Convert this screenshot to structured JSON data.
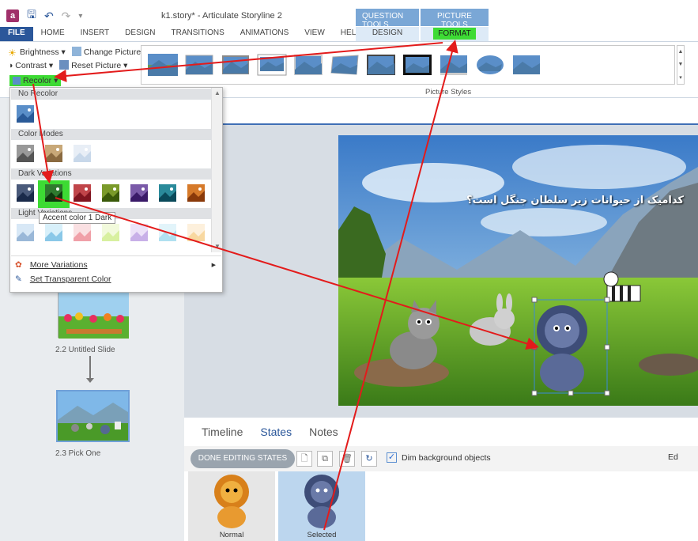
{
  "window": {
    "title": "k1.story* - Articulate Storyline 2",
    "context_tabs": {
      "question_tools": "QUESTION TOOLS",
      "picture_tools": "PICTURE TOOLS"
    }
  },
  "ribbon": {
    "tabs": [
      "FILE",
      "HOME",
      "INSERT",
      "DESIGN",
      "TRANSITIONS",
      "ANIMATIONS",
      "VIEW",
      "HELP"
    ],
    "context_design": "DESIGN",
    "context_format": "FORMAT",
    "adjust": {
      "brightness": "Brightness",
      "change_picture": "Change Picture",
      "contrast": "Contrast",
      "reset_picture": "Reset Picture",
      "recolor": "Recolor"
    },
    "picture_styles_label": "Picture Styles"
  },
  "recolor_menu": {
    "sections": {
      "no_recolor": "No Recolor",
      "color_modes": "Color Modes",
      "dark_variations": "Dark Variations",
      "light_variations": "Light Variations"
    },
    "tooltip": "Accent color 1 Dark",
    "more_variations": "More Variations",
    "set_transparent": "Set Transparent Color",
    "dark_colors": [
      "#4a5a7a",
      "#2f7a2f",
      "#c0454a",
      "#7a9a2a",
      "#7a5aa8",
      "#2a8a9a",
      "#d67a2a"
    ],
    "light_colors": [
      "#9ab8d8",
      "#8ac8e8",
      "#f0a0a8",
      "#d8f0a0",
      "#c8b0e8",
      "#b0e0f0",
      "#f8d8a0"
    ]
  },
  "slides": {
    "slide_22": "2.2 Untitled Slide",
    "slide_23": "2.3 Pick One"
  },
  "stage": {
    "question_text": "کدامیک از حیوانات زیر سلطان جنگل است؟"
  },
  "bottom_panel": {
    "tabs": [
      "Timeline",
      "States",
      "Notes"
    ],
    "done_button": "DONE EDITING STATES",
    "dim_background": "Dim background objects",
    "edit_cut": "Ed",
    "states": [
      "Normal",
      "Selected"
    ]
  },
  "colors": {
    "accent_blue": "#2b579a",
    "highlight_green": "#3ddb34",
    "arrow_red": "#e31b1b"
  }
}
